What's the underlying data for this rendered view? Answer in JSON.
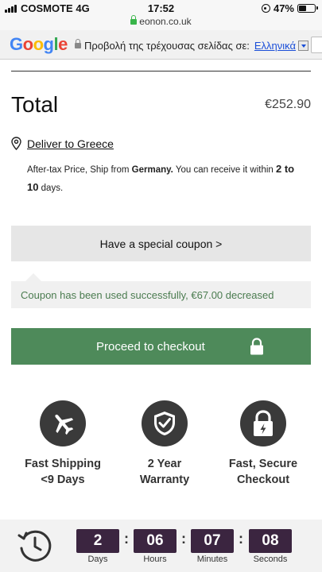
{
  "status_bar": {
    "carrier": "COSMOTE 4G",
    "time": "17:52",
    "url": "eonon.co.uk",
    "battery": "47%",
    "battery_level": 0.47
  },
  "translate_bar": {
    "logo": "Google",
    "prompt": "Προβολή της τρέχουσας σελίδας σε:",
    "language": "Ελληνικά",
    "logo_colors": [
      "#4285F4",
      "#EA4335",
      "#FBBC05",
      "#4285F4",
      "#34A853",
      "#EA4335"
    ]
  },
  "order": {
    "total_label": "Total",
    "total_value": "€252.90",
    "deliver_link": "Deliver to Greece",
    "note_prefix": "After-tax Price, Ship from ",
    "note_country": "Germany.",
    "note_middle": " You can receive it within ",
    "note_range": "2 to 10",
    "note_suffix": " days."
  },
  "coupon": {
    "button_label": "Have a special coupon >",
    "message": "Coupon has been used successfully, €67.00 decreased"
  },
  "checkout": {
    "label": "Proceed to checkout",
    "color": "#4e8a5a"
  },
  "features": [
    {
      "icon": "airplane-icon",
      "line1": "Fast Shipping",
      "line2": "<9 Days"
    },
    {
      "icon": "shield-check-icon",
      "line1": "2 Year",
      "line2": "Warranty"
    },
    {
      "icon": "secure-lock-icon",
      "line1": "Fast, Secure",
      "line2": "Checkout"
    }
  ],
  "countdown": {
    "icon": "history-clock-icon",
    "units": [
      {
        "value": "2",
        "label": "Days"
      },
      {
        "value": "06",
        "label": "Hours"
      },
      {
        "value": "07",
        "label": "Minutes"
      },
      {
        "value": "08",
        "label": "Seconds"
      }
    ],
    "separator": ":",
    "box_color": "#3b2540"
  }
}
